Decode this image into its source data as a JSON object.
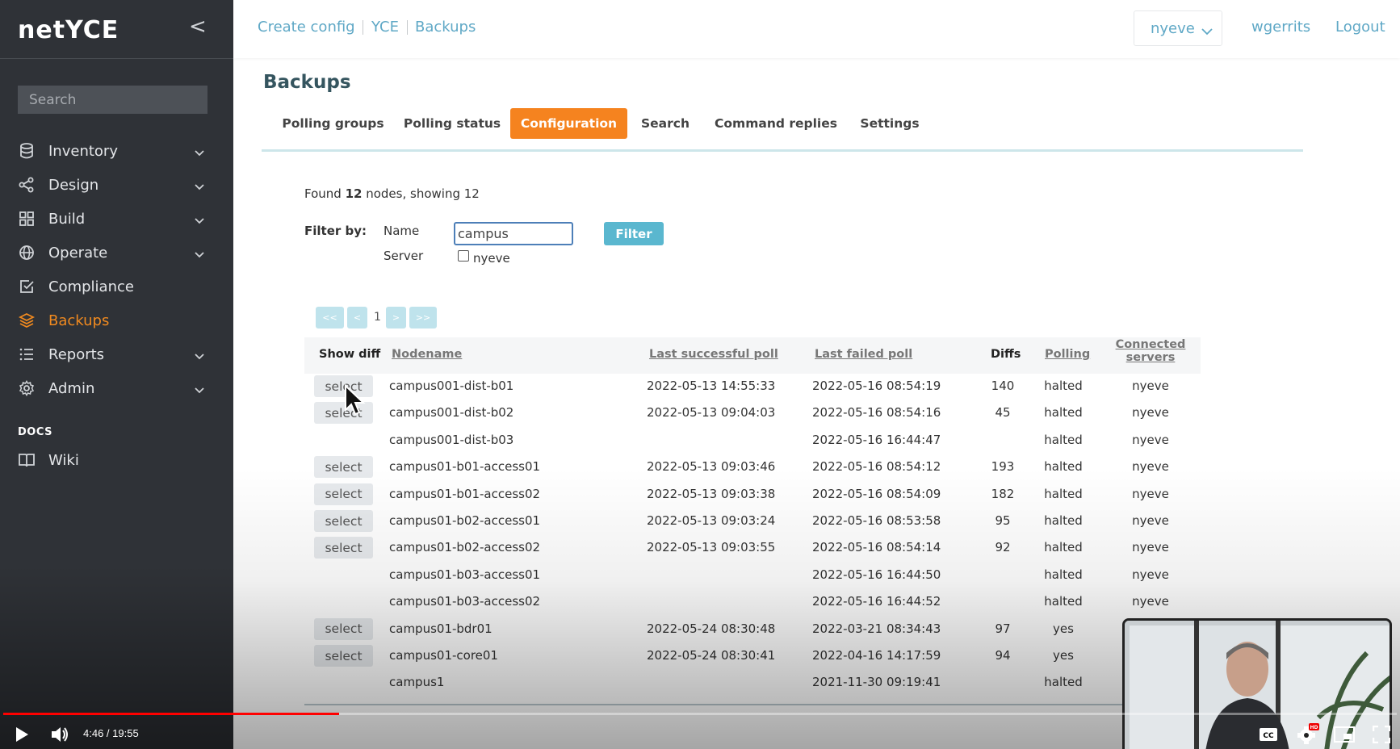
{
  "app": {
    "logo": "netYCE",
    "collapse_glyph": "<"
  },
  "sidebar": {
    "search_placeholder": "Search",
    "items": [
      {
        "label": "Inventory",
        "icon": "database-icon",
        "chevron": true
      },
      {
        "label": "Design",
        "icon": "share-icon",
        "chevron": true
      },
      {
        "label": "Build",
        "icon": "grid-icon",
        "chevron": true
      },
      {
        "label": "Operate",
        "icon": "globe-icon",
        "chevron": true
      },
      {
        "label": "Compliance",
        "icon": "checkbox-icon",
        "chevron": false
      },
      {
        "label": "Backups",
        "icon": "layers-icon",
        "chevron": false,
        "active": true
      },
      {
        "label": "Reports",
        "icon": "list-icon",
        "chevron": true
      },
      {
        "label": "Admin",
        "icon": "gear-icon",
        "chevron": true
      }
    ],
    "docs_heading": "DOCS",
    "docs_items": [
      {
        "label": "Wiki",
        "icon": "book-icon"
      }
    ],
    "accent_color": "#f18a1f"
  },
  "header": {
    "breadcrumbs": [
      "Create config",
      "YCE",
      "Backups"
    ],
    "server_select_value": "nyeve",
    "user": "wgerrits",
    "logout": "Logout",
    "link_color": "#5fa8c6"
  },
  "page": {
    "title": "Backups",
    "tabs": [
      {
        "label": "Polling groups"
      },
      {
        "label": "Polling status"
      },
      {
        "label": "Configuration",
        "active": true
      },
      {
        "label": "Search"
      },
      {
        "label": "Command replies"
      },
      {
        "label": "Settings"
      }
    ],
    "tab_active_color": "#f5831f",
    "found": {
      "prefix": "Found ",
      "count": "12",
      "suffix": " nodes, showing 12"
    },
    "filter": {
      "label": "Filter by:",
      "name_label": "Name",
      "name_value": "campus",
      "server_label": "Server",
      "server_option": "nyeve",
      "button": "Filter"
    },
    "pagination": {
      "first": "<<",
      "prev": "<",
      "page": "1",
      "next": ">",
      "last": ">>"
    }
  },
  "table": {
    "headers": {
      "show_diff": "Show diff",
      "nodename": "Nodename",
      "last_success": "Last successful poll",
      "last_failed": "Last failed poll",
      "diffs": "Diffs",
      "polling": "Polling",
      "connected_1": "Connected",
      "connected_2": "servers"
    },
    "select_label": "select",
    "rows": [
      {
        "select": true,
        "node": "campus001-dist-b01",
        "success": "2022-05-13 14:55:33",
        "failed": "2022-05-16 08:54:19",
        "diffs": "140",
        "polling": "halted",
        "servers": "nyeve"
      },
      {
        "select": true,
        "node": "campus001-dist-b02",
        "success": "2022-05-13 09:04:03",
        "failed": "2022-05-16 08:54:16",
        "diffs": "45",
        "polling": "halted",
        "servers": "nyeve"
      },
      {
        "select": false,
        "node": "campus001-dist-b03",
        "success": "",
        "failed": "2022-05-16 16:44:47",
        "diffs": "",
        "polling": "halted",
        "servers": "nyeve"
      },
      {
        "select": true,
        "node": "campus01-b01-access01",
        "success": "2022-05-13 09:03:46",
        "failed": "2022-05-16 08:54:12",
        "diffs": "193",
        "polling": "halted",
        "servers": "nyeve"
      },
      {
        "select": true,
        "node": "campus01-b01-access02",
        "success": "2022-05-13 09:03:38",
        "failed": "2022-05-16 08:54:09",
        "diffs": "182",
        "polling": "halted",
        "servers": "nyeve"
      },
      {
        "select": true,
        "node": "campus01-b02-access01",
        "success": "2022-05-13 09:03:24",
        "failed": "2022-05-16 08:53:58",
        "diffs": "95",
        "polling": "halted",
        "servers": "nyeve"
      },
      {
        "select": true,
        "node": "campus01-b02-access02",
        "success": "2022-05-13 09:03:55",
        "failed": "2022-05-16 08:54:14",
        "diffs": "92",
        "polling": "halted",
        "servers": "nyeve"
      },
      {
        "select": false,
        "node": "campus01-b03-access01",
        "success": "",
        "failed": "2022-05-16 16:44:50",
        "diffs": "",
        "polling": "halted",
        "servers": "nyeve"
      },
      {
        "select": false,
        "node": "campus01-b03-access02",
        "success": "",
        "failed": "2022-05-16 16:44:52",
        "diffs": "",
        "polling": "halted",
        "servers": "nyeve"
      },
      {
        "select": true,
        "node": "campus01-bdr01",
        "success": "2022-05-24 08:30:48",
        "failed": "2022-03-21 08:34:43",
        "diffs": "97",
        "polling": "yes",
        "servers": ""
      },
      {
        "select": true,
        "node": "campus01-core01",
        "success": "2022-05-24 08:30:41",
        "failed": "2022-04-16 14:17:59",
        "diffs": "94",
        "polling": "yes",
        "servers": ""
      },
      {
        "select": false,
        "node": "campus1",
        "success": "",
        "failed": "2021-11-30 09:19:41",
        "diffs": "",
        "polling": "halted",
        "servers": ""
      }
    ]
  },
  "video": {
    "time": "4:46 / 19:55",
    "progress": 0.241,
    "hd_badge": "HD"
  }
}
